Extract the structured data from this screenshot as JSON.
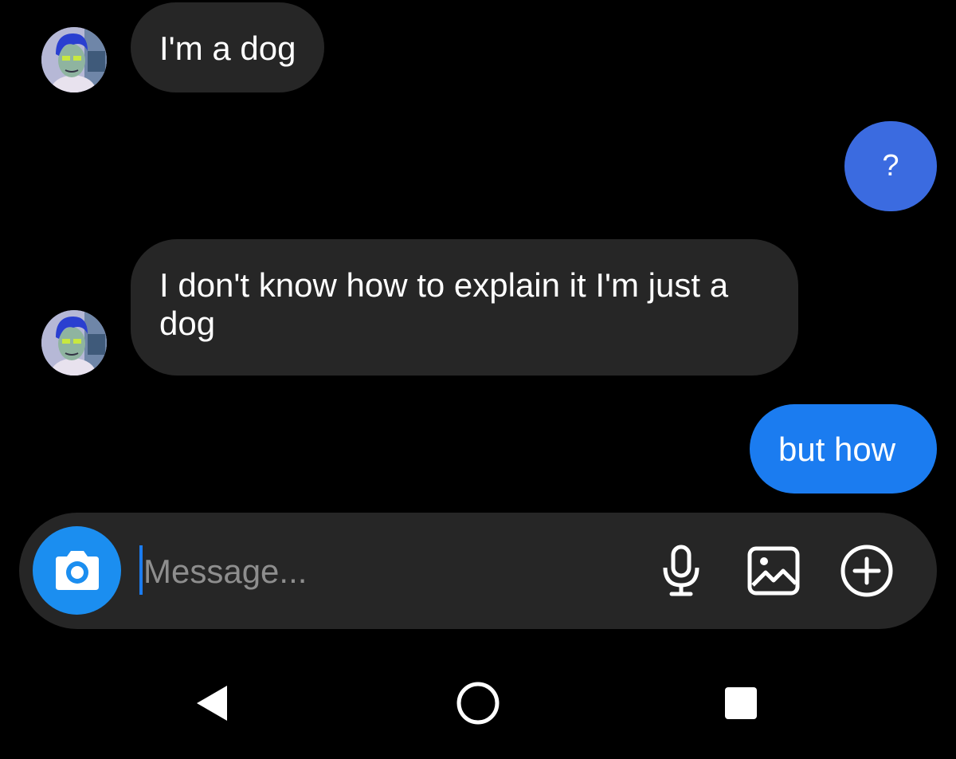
{
  "conversation": {
    "messages": [
      {
        "sender": "other",
        "text": "I'm a dog"
      },
      {
        "sender": "me",
        "text": "?"
      },
      {
        "sender": "other",
        "text": "I don't know how to explain it I'm just a dog"
      },
      {
        "sender": "me",
        "text": "but how"
      }
    ]
  },
  "composer": {
    "placeholder": "Message...",
    "value": "",
    "icons": [
      "camera-icon",
      "microphone-icon",
      "gallery-icon",
      "add-icon"
    ]
  },
  "navigation_bar": {
    "icons": [
      "back-icon",
      "home-icon",
      "recents-icon"
    ]
  },
  "colors": {
    "background": "#000000",
    "incoming_bubble": "#262626",
    "outgoing_bubble": "#1b7cf0",
    "question_bubble": "#3b6be0",
    "accent": "#1b8ef0",
    "text": "#ffffff",
    "placeholder": "#8e8e8e"
  }
}
